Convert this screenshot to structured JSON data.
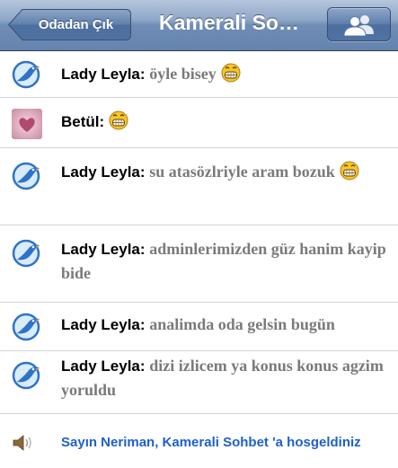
{
  "navbar": {
    "back_label": "Odadan Çık",
    "title": "Kamerali So…",
    "users_icon": "group-users-icon"
  },
  "messages": [
    {
      "sender": "Lady Leyla:",
      "text": "öyle bisey",
      "emoji": true,
      "avatar": "bird-avatar-icon"
    },
    {
      "sender": "Betül:",
      "text": "",
      "emoji": true,
      "avatar": "pink-heart-photo"
    },
    {
      "sender": "Lady Leyla:",
      "text": "su atasözlriyle aram bozuk",
      "emoji": true,
      "avatar": "bird-avatar-icon"
    },
    {
      "sender": "Lady Leyla:",
      "text": "adminlerimizden güz hanim kayip bide",
      "emoji": false,
      "avatar": "bird-avatar-icon"
    },
    {
      "sender": "Lady Leyla:",
      "text": "analimda oda gelsin bugün",
      "emoji": false,
      "avatar": "bird-avatar-icon"
    },
    {
      "sender": "Lady Leyla:",
      "text": "dizi izlicem ya konus konus agzim yoruldu",
      "emoji": false,
      "avatar": "bird-avatar-icon"
    }
  ],
  "notice": {
    "text": "Sayın Neriman, Kamerali Sohbet 'a hosgeldiniz",
    "icon": "speaker-icon"
  },
  "colors": {
    "navbar": "#6f8db6",
    "sender": "#000000",
    "message_text": "#7a7a7a",
    "notice_text": "#1e5fd0",
    "separator": "#d4d4d4"
  }
}
